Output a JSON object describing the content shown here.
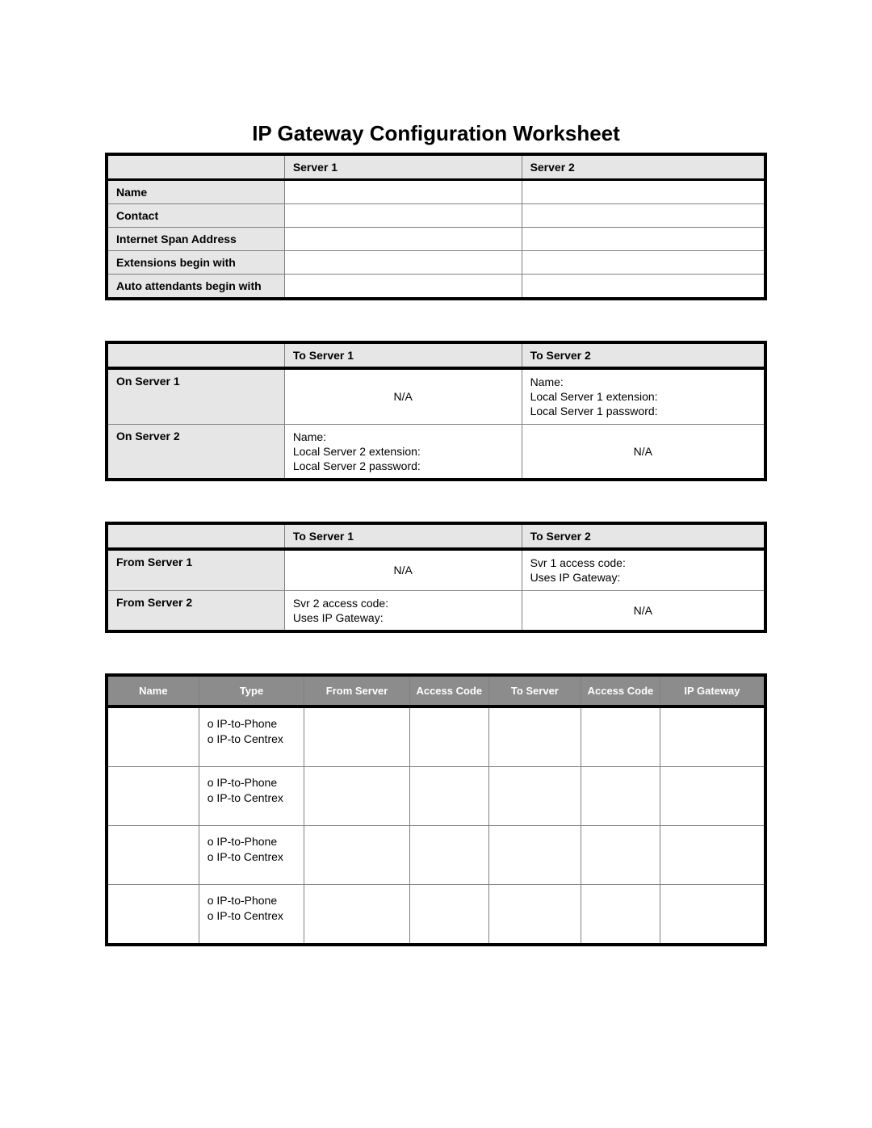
{
  "title": "IP Gateway Configuration Worksheet",
  "table1": {
    "head": {
      "blank": "",
      "s1": "Server 1",
      "s2": "Server 2"
    },
    "rows": [
      {
        "label": "Name",
        "v1": "",
        "v2": ""
      },
      {
        "label": "Contact",
        "v1": "",
        "v2": ""
      },
      {
        "label": "Internet Span Address",
        "v1": "",
        "v2": ""
      },
      {
        "label": "Extensions begin with",
        "v1": "",
        "v2": ""
      },
      {
        "label": "Auto attendants begin with",
        "v1": "",
        "v2": ""
      }
    ]
  },
  "table2": {
    "head": {
      "blank": "",
      "s1": "To Server 1",
      "s2": "To Server 2"
    },
    "rows": [
      {
        "label": "On Server 1",
        "c1": "N/A",
        "c1_center": true,
        "c2": "Name:\nLocal Server 1 extension:\nLocal Server 1 password:",
        "c2_center": false
      },
      {
        "label": "On Server 2",
        "c1": "Name:\nLocal Server 2 extension:\nLocal Server 2 password:",
        "c1_center": false,
        "c2": "N/A",
        "c2_center": true
      }
    ]
  },
  "table3": {
    "head": {
      "blank": "",
      "s1": "To Server 1",
      "s2": "To Server 2"
    },
    "rows": [
      {
        "label": "From Server 1",
        "c1": "N/A",
        "c1_center": true,
        "c2": "Svr 1 access code:\nUses IP Gateway:",
        "c2_center": false
      },
      {
        "label": "From Server 2",
        "c1": "Svr 2 access code:\nUses IP Gateway:",
        "c1_center": false,
        "c2": "N/A",
        "c2_center": true
      }
    ]
  },
  "table4": {
    "head": {
      "name": "Name",
      "type": "Type",
      "from": "From Server",
      "ac1": "Access Code",
      "to": "To Server",
      "ac2": "Access Code",
      "gw": "IP Gateway"
    },
    "type_options": "o IP-to-Phone\no IP-to Centrex",
    "rows": 4
  }
}
